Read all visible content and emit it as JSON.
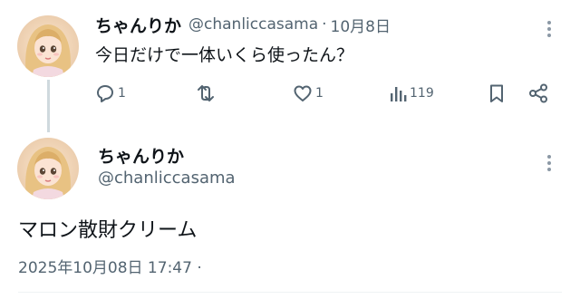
{
  "parent_tweet": {
    "display_name": "ちゃんりか",
    "handle": "@chanliccasama",
    "separator": "·",
    "date": "10月8日",
    "text": "今日だけで一体いくら使ったん？",
    "avatar_icon": "doll-avatar-icon",
    "actions": {
      "reply_count": "1",
      "repost_count": "",
      "like_count": "1",
      "views_count": "119"
    }
  },
  "reply_tweet": {
    "display_name": "ちゃんりか",
    "handle": "@chanliccasama",
    "text": "マロン散財クリーム",
    "timestamp": "2025年10月08日 17:47 ·",
    "avatar_icon": "doll-avatar-icon"
  },
  "colors": {
    "primary_text": "#0f1419",
    "secondary_text": "#536471",
    "thread_line": "#cfd9de",
    "background": "#ffffff"
  }
}
